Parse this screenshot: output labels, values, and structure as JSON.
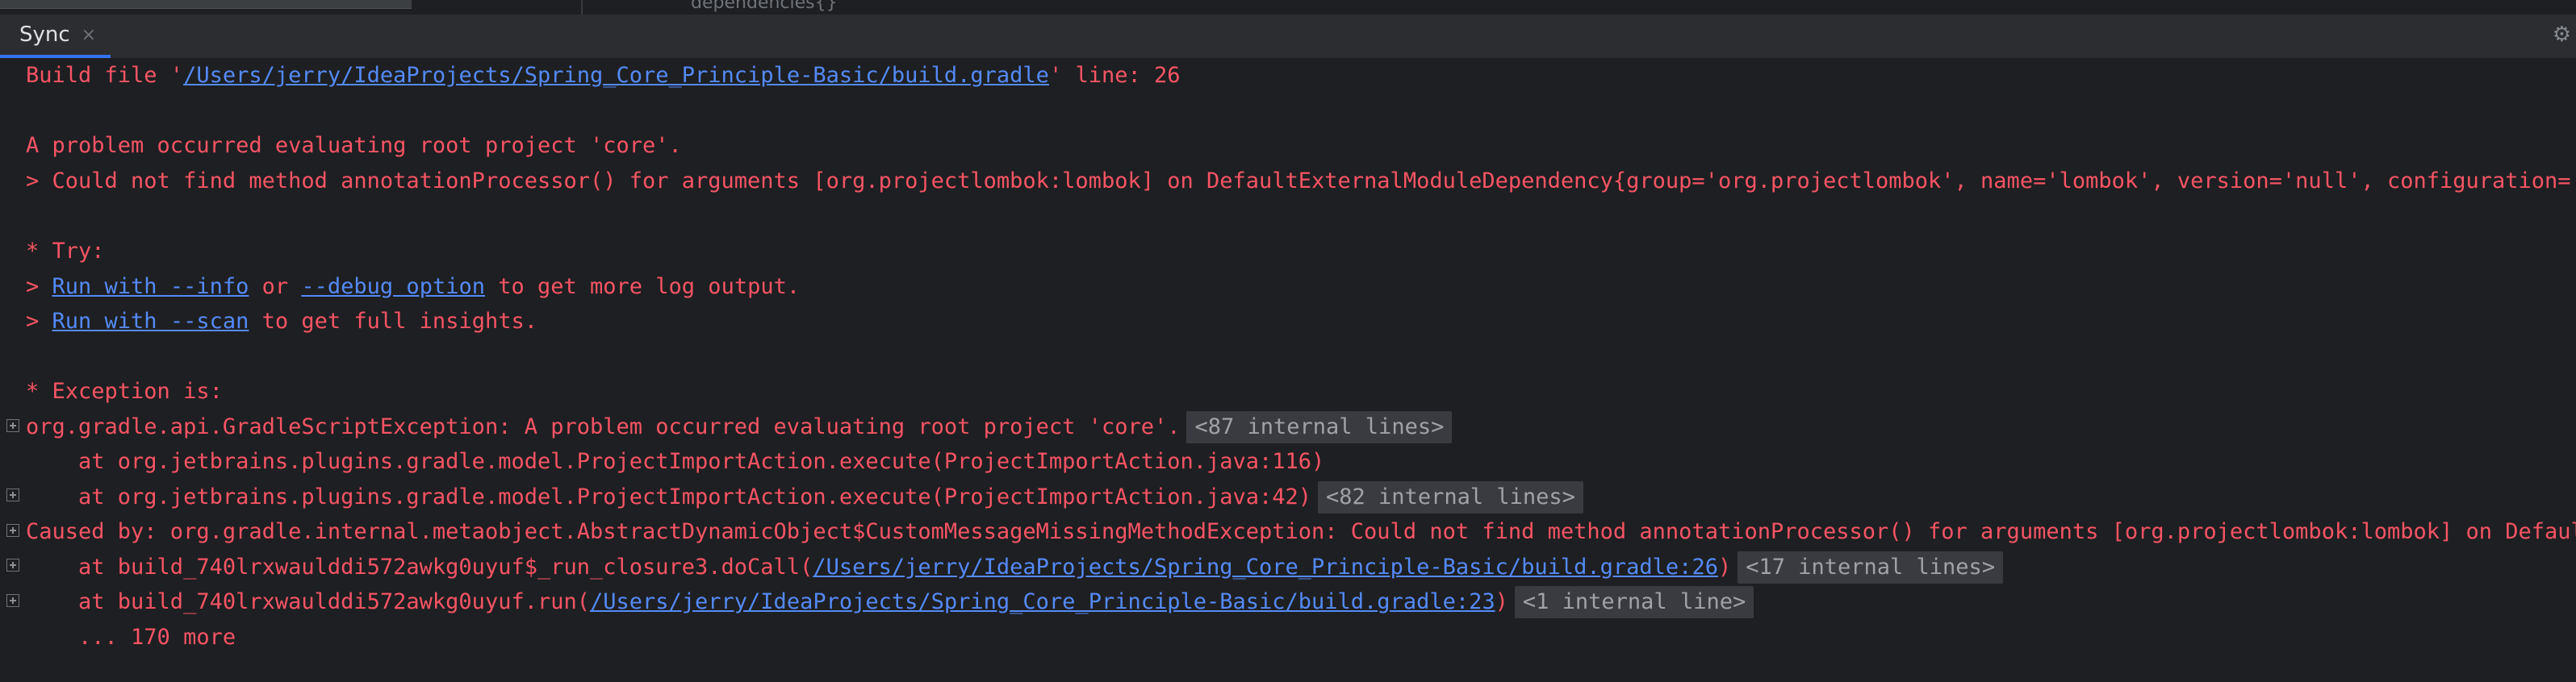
{
  "top": {
    "crumb": "dependencies{}"
  },
  "tab": {
    "label": "Sync",
    "close": "×"
  },
  "colors": {
    "error": "#f75464",
    "link": "#548af7",
    "accent": "#3574f0"
  },
  "lines": {
    "l1": {
      "a": "Build file '",
      "link": "/Users/jerry/IdeaProjects/Spring_Core_Principle-Basic/build.gradle",
      "b": "' line: 26"
    },
    "l3": "A problem occurred evaluating root project 'core'.",
    "l4": "> Could not find method annotationProcessor() for arguments [org.projectlombok:lombok] on DefaultExternalModuleDependency{group='org.projectlombok', name='lombok', version='null', configuration='default'",
    "l6": "* Try:",
    "l7": {
      "a": "> ",
      "link1": "Run with --info",
      "b": " or ",
      "link2": "--debug option",
      "c": " to get more log output."
    },
    "l8": {
      "a": "> ",
      "link1": "Run with --scan",
      "b": " to get full insights."
    },
    "l10": "* Exception is:",
    "l11": {
      "text": "org.gradle.api.GradleScriptException: A problem occurred evaluating root project 'core'.",
      "chip": "<87 internal lines>"
    },
    "l12": "    at org.jetbrains.plugins.gradle.model.ProjectImportAction.execute(ProjectImportAction.java:116)",
    "l13": {
      "text": "    at org.jetbrains.plugins.gradle.model.ProjectImportAction.execute(ProjectImportAction.java:42)",
      "chip": "<82 internal lines>"
    },
    "l14": "Caused by: org.gradle.internal.metaobject.AbstractDynamicObject$CustomMessageMissingMethodException: Could not find method annotationProcessor() for arguments [org.projectlombok:lombok] on DefaultExterna",
    "l15": {
      "a": "    at build_740lrxwaulddi572awkg0uyuf$_run_closure3.doCall(",
      "link": "/Users/jerry/IdeaProjects/Spring_Core_Principle-Basic/build.gradle:26",
      "b": ")",
      "chip": "<17 internal lines>"
    },
    "l16": {
      "a": "    at build_740lrxwaulddi572awkg0uyuf.run(",
      "link": "/Users/jerry/IdeaProjects/Spring_Core_Principle-Basic/build.gradle:23",
      "b": ")",
      "chip": "<1 internal line>"
    },
    "l17": "    ... 170 more"
  }
}
